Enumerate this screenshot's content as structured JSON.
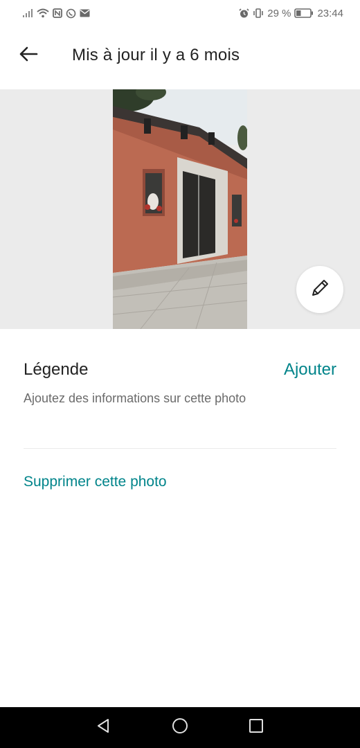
{
  "status_bar": {
    "battery_percent": "29 %",
    "time": "23:44",
    "icons_left": [
      "signal-icon",
      "wifi-icon",
      "nfc-icon",
      "whatsapp-icon",
      "mail-icon"
    ],
    "icons_right": [
      "alarm-icon",
      "vibrate-icon",
      "battery-icon"
    ]
  },
  "header": {
    "title": "Mis à jour il y a 6 mois",
    "back_icon": "arrow-left-icon"
  },
  "photo": {
    "edit_icon": "pencil-icon"
  },
  "caption": {
    "label": "Légende",
    "add_label": "Ajouter",
    "hint": "Ajoutez des informations sur cette photo"
  },
  "actions": {
    "delete_label": "Supprimer cette photo"
  },
  "nav_bar": {
    "buttons": [
      "back-triangle-icon",
      "home-circle-icon",
      "recents-square-icon"
    ]
  },
  "colors": {
    "accent": "#00848a",
    "text_primary": "#222222",
    "text_secondary": "#6a6a6a",
    "photo_background": "#ebebeb"
  }
}
